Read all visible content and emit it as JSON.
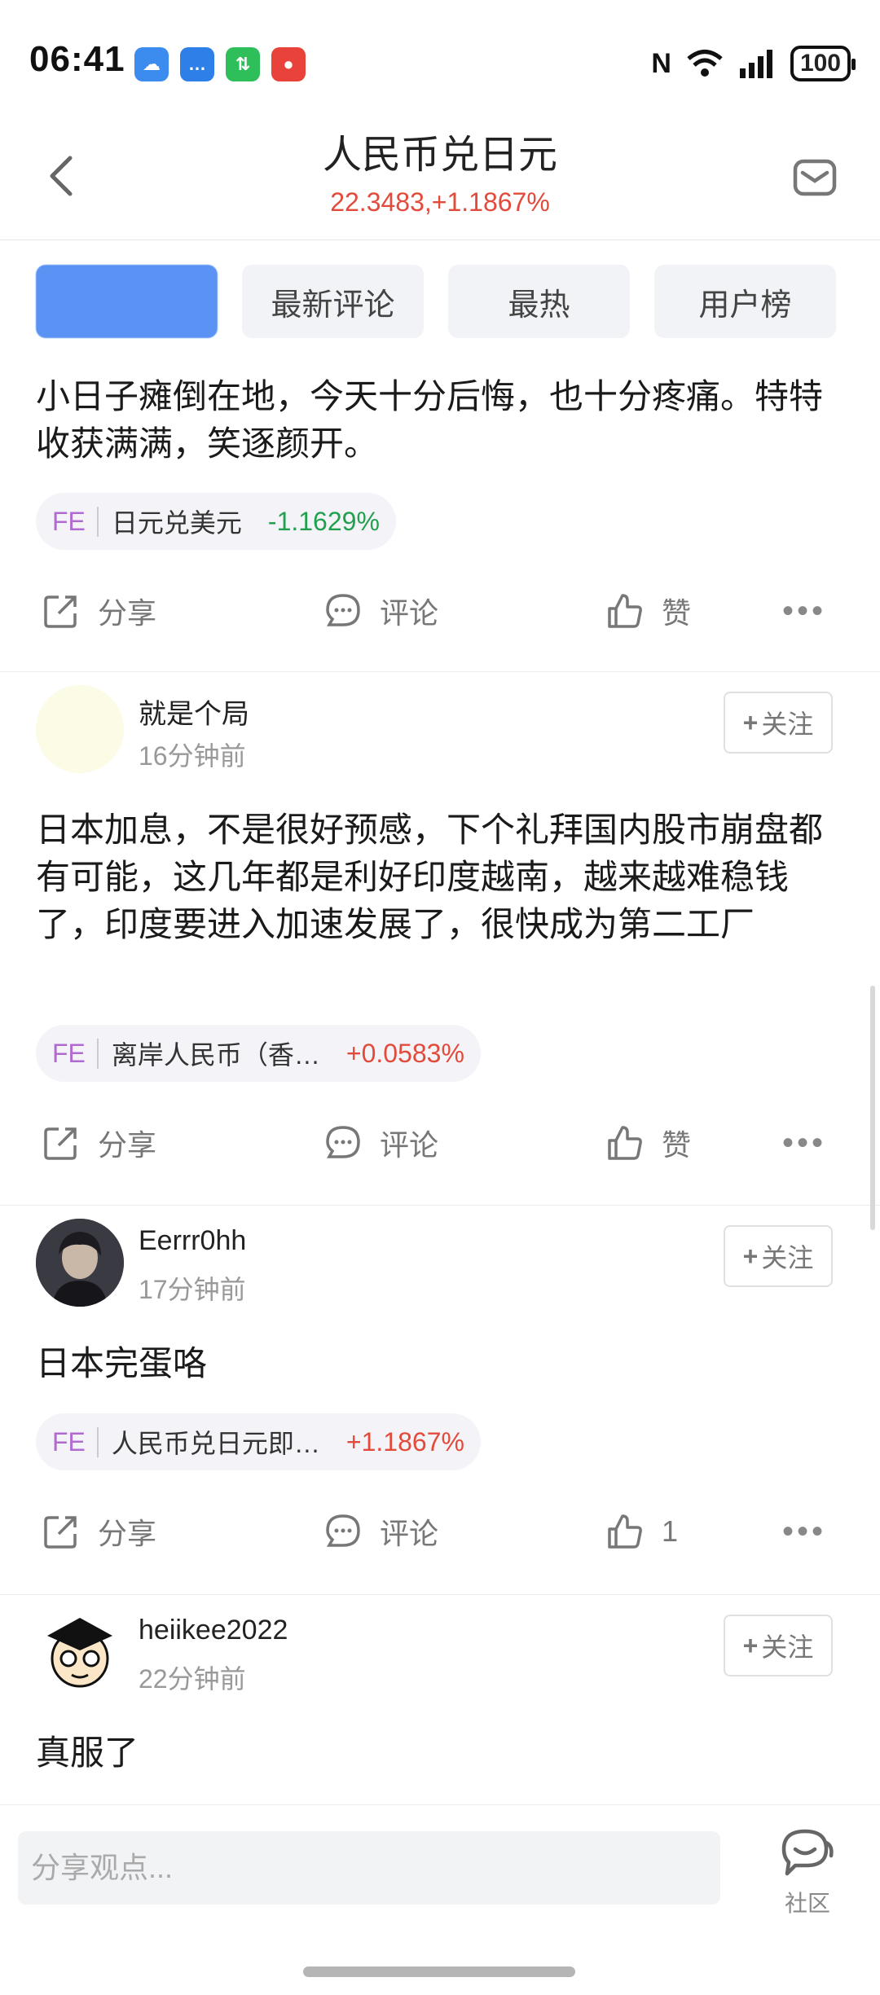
{
  "status_bar": {
    "time": "06:41",
    "battery": "100",
    "app_icons": [
      "cloud-app-icon",
      "chat-app-icon",
      "green-app-icon",
      "red-app-icon"
    ]
  },
  "header": {
    "title": "人民币兑日元",
    "subtitle": "22.3483,+1.1867%"
  },
  "tabs": [
    {
      "label": "",
      "active": true
    },
    {
      "label": "最新评论"
    },
    {
      "label": "最热"
    },
    {
      "label": "用户榜"
    }
  ],
  "colors": {
    "up": "#e24b3b",
    "down": "#22a050",
    "accent": "#5b93f5"
  },
  "actions": {
    "share": "分享",
    "comment": "评论",
    "like": "赞"
  },
  "follow_label": "关注",
  "posts": [
    {
      "text": "小日子瘫倒在地，今天十分后悔，也十分疼痛。特特收获满满，笑逐颜开。",
      "chip": {
        "tag": "FE",
        "name": "日元兑美元",
        "change": "-1.1629%"
      },
      "likes": "赞"
    },
    {
      "username": "就是个局",
      "time": "16分钟前",
      "text": "日本加息，不是很好预感，下个礼拜国内股市崩盘都有可能，这几年都是利好印度越南，越来越难稳钱了，印度要进入加速发展了，很快成为第二工厂",
      "chip": {
        "tag": "FE",
        "name": "离岸人民币（香…",
        "change": "+0.0583%"
      },
      "likes": "赞"
    },
    {
      "username": "Eerrr0hh",
      "time": "17分钟前",
      "text": "日本完蛋咯",
      "chip": {
        "tag": "FE",
        "name": "人民币兑日元即…",
        "change": "+1.1867%"
      },
      "likes": "1"
    },
    {
      "username": "heiikee2022",
      "time": "22分钟前",
      "text": "真服了"
    }
  ],
  "bottom": {
    "placeholder": "分享观点...",
    "community_label": "社区"
  }
}
